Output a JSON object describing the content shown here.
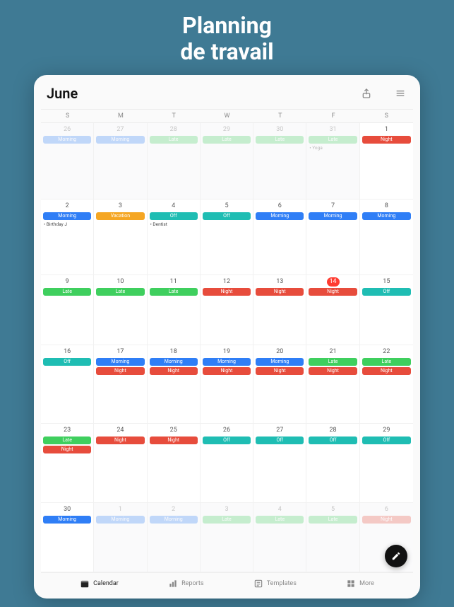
{
  "promo": {
    "line1": "Planning",
    "line2": "de travail"
  },
  "header": {
    "month": "June"
  },
  "weekdays": [
    "S",
    "M",
    "T",
    "W",
    "T",
    "F",
    "S"
  ],
  "shift_colors": {
    "Morning": "#2f7ef6",
    "Late": "#3fcf5e",
    "Night": "#e74c3c",
    "Off": "#1fbdb3",
    "Vacation": "#f5a623"
  },
  "days": [
    {
      "num": "26",
      "other": true,
      "shifts": [
        "Morning"
      ],
      "notes": []
    },
    {
      "num": "27",
      "other": true,
      "shifts": [
        "Morning"
      ],
      "notes": []
    },
    {
      "num": "28",
      "other": true,
      "shifts": [
        "Late"
      ],
      "notes": []
    },
    {
      "num": "29",
      "other": true,
      "shifts": [
        "Late"
      ],
      "notes": []
    },
    {
      "num": "30",
      "other": true,
      "shifts": [
        "Late"
      ],
      "notes": []
    },
    {
      "num": "31",
      "other": true,
      "shifts": [
        "Late"
      ],
      "notes": [
        "• Yoga"
      ]
    },
    {
      "num": "1",
      "other": false,
      "shifts": [
        "Night"
      ],
      "notes": []
    },
    {
      "num": "2",
      "other": false,
      "shifts": [
        "Morning"
      ],
      "notes": [
        "• Birthday J"
      ]
    },
    {
      "num": "3",
      "other": false,
      "shifts": [
        "Vacation"
      ],
      "notes": []
    },
    {
      "num": "4",
      "other": false,
      "shifts": [
        "Off"
      ],
      "notes": [
        "• Dentist"
      ]
    },
    {
      "num": "5",
      "other": false,
      "shifts": [
        "Off"
      ],
      "notes": []
    },
    {
      "num": "6",
      "other": false,
      "shifts": [
        "Morning"
      ],
      "notes": []
    },
    {
      "num": "7",
      "other": false,
      "shifts": [
        "Morning"
      ],
      "notes": []
    },
    {
      "num": "8",
      "other": false,
      "shifts": [
        "Morning"
      ],
      "notes": []
    },
    {
      "num": "9",
      "other": false,
      "shifts": [
        "Late"
      ],
      "notes": []
    },
    {
      "num": "10",
      "other": false,
      "shifts": [
        "Late"
      ],
      "notes": []
    },
    {
      "num": "11",
      "other": false,
      "shifts": [
        "Late"
      ],
      "notes": []
    },
    {
      "num": "12",
      "other": false,
      "shifts": [
        "Night"
      ],
      "notes": []
    },
    {
      "num": "13",
      "other": false,
      "shifts": [
        "Night"
      ],
      "notes": []
    },
    {
      "num": "14",
      "other": false,
      "today": true,
      "shifts": [
        "Night"
      ],
      "notes": []
    },
    {
      "num": "15",
      "other": false,
      "shifts": [
        "Off"
      ],
      "notes": []
    },
    {
      "num": "16",
      "other": false,
      "shifts": [
        "Off"
      ],
      "notes": []
    },
    {
      "num": "17",
      "other": false,
      "shifts": [
        "Morning",
        "Night"
      ],
      "notes": []
    },
    {
      "num": "18",
      "other": false,
      "shifts": [
        "Morning",
        "Night"
      ],
      "notes": []
    },
    {
      "num": "19",
      "other": false,
      "shifts": [
        "Morning",
        "Night"
      ],
      "notes": []
    },
    {
      "num": "20",
      "other": false,
      "shifts": [
        "Morning",
        "Night"
      ],
      "notes": []
    },
    {
      "num": "21",
      "other": false,
      "shifts": [
        "Late",
        "Night"
      ],
      "notes": []
    },
    {
      "num": "22",
      "other": false,
      "shifts": [
        "Late",
        "Night"
      ],
      "notes": []
    },
    {
      "num": "23",
      "other": false,
      "shifts": [
        "Late",
        "Night"
      ],
      "notes": []
    },
    {
      "num": "24",
      "other": false,
      "shifts": [
        "Night"
      ],
      "notes": []
    },
    {
      "num": "25",
      "other": false,
      "shifts": [
        "Night"
      ],
      "notes": []
    },
    {
      "num": "26",
      "other": false,
      "shifts": [
        "Off"
      ],
      "notes": []
    },
    {
      "num": "27",
      "other": false,
      "shifts": [
        "Off"
      ],
      "notes": []
    },
    {
      "num": "28",
      "other": false,
      "shifts": [
        "Off"
      ],
      "notes": []
    },
    {
      "num": "29",
      "other": false,
      "shifts": [
        "Off"
      ],
      "notes": []
    },
    {
      "num": "30",
      "other": false,
      "shifts": [
        "Morning"
      ],
      "notes": []
    },
    {
      "num": "1",
      "other": true,
      "shifts": [
        "Morning"
      ],
      "notes": []
    },
    {
      "num": "2",
      "other": true,
      "shifts": [
        "Morning"
      ],
      "notes": []
    },
    {
      "num": "3",
      "other": true,
      "shifts": [
        "Late"
      ],
      "notes": []
    },
    {
      "num": "4",
      "other": true,
      "shifts": [
        "Late"
      ],
      "notes": []
    },
    {
      "num": "5",
      "other": true,
      "shifts": [
        "Late"
      ],
      "notes": []
    },
    {
      "num": "6",
      "other": true,
      "shifts": [
        "Night"
      ],
      "notes": []
    }
  ],
  "tabs": [
    {
      "id": "calendar",
      "label": "Calendar",
      "active": true
    },
    {
      "id": "reports",
      "label": "Reports",
      "active": false
    },
    {
      "id": "templates",
      "label": "Templates",
      "active": false
    },
    {
      "id": "more",
      "label": "More",
      "active": false
    }
  ]
}
